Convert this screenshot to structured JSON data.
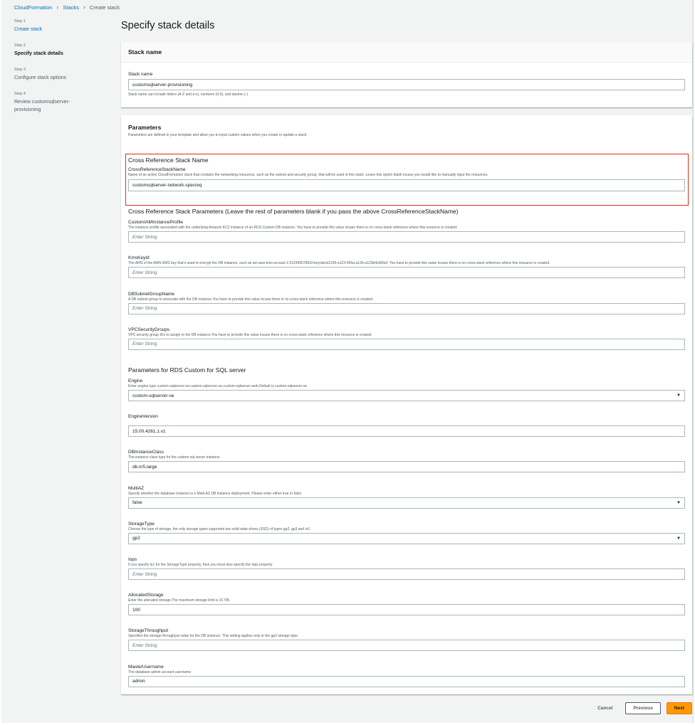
{
  "breadcrumb": {
    "items": [
      "CloudFormation",
      "Stacks",
      "Create stack"
    ]
  },
  "steps": [
    {
      "num": "Step 1",
      "label": "Create stack"
    },
    {
      "num": "Step 2",
      "label": "Specify stack details"
    },
    {
      "num": "Step 3",
      "label": "Configure stack options"
    },
    {
      "num": "Step 4",
      "label": "Review customsqlserver-provisioning"
    }
  ],
  "page_title": "Specify stack details",
  "stack_name_panel": {
    "title": "Stack name",
    "label": "Stack name",
    "value": "customsqlserver-provisioning",
    "hint": "Stack name can include letters (A-Z and a-z), numbers (0-9), and dashes (-)."
  },
  "parameters_panel": {
    "title": "Parameters",
    "desc": "Parameters are defined in your template and allow you to input custom values when you create or update a stack.",
    "crossref": {
      "heading": "Cross Reference Stack Name",
      "label": "CrossReferenceStackName",
      "desc": "Name of an active CloudFormation stack that contains the networking resources, such as the subnet and security group, that will be used in this stack. Leave this option blank incase you would like to manually input the resources.",
      "value": "customsqlserver-network-specreq"
    },
    "crossref_params_heading": "Cross Reference Stack Parameters (Leave the rest of parameters blank if you pass the above CrossReferenceStackName)",
    "crossref_fields": [
      {
        "label": "CustomIAMInstanceProfile",
        "desc": "The instance profile associated with the underlying Amazon EC2 instance of an RDS Custom DB instance. You have to provide this value incase there is no cross-stack reference where this resource is created.",
        "placeholder": "Enter String"
      },
      {
        "label": "KmsKeyId",
        "desc": "The ARN of the AWS KMS key that's used to encrypt the DB instance, such as arn:aws:kms:us-east-1:012345678910:key/abcd1234-a123-456a-a12b-a123b4cd56ef. You have to provide this value incase there is no cross-stack reference where this resource is created.",
        "placeholder": "Enter String"
      },
      {
        "label": "DBSubnetGroupName",
        "desc": "A DB subnet group to associate with the DB instance.You have to provide this value incase there is no cross-stack reference where this resource is created.",
        "placeholder": "Enter String"
      },
      {
        "label": "VPCSecurityGroups",
        "desc": "VPC security group IDs to assign to the DB instance.You have to provide this value incase there is no cross-stack reference where this resource is created.",
        "placeholder": "Enter String"
      }
    ],
    "rds_heading": "Parameters for RDS Custom for SQL server",
    "rds_fields": [
      {
        "label": "Engine",
        "desc": "Enter engine type custom-sqlserver-ee,custom-sqlserver-se,custom-sqlserver-web.Default is custom-sqlserver-se",
        "value": "custom-sqlserver-se",
        "type": "select"
      },
      {
        "label": "EngineVersion",
        "desc": "",
        "value": "15.00.4261.1.v1",
        "type": "input"
      },
      {
        "label": "DBInstanceClass",
        "desc": "The instance class type for the custom sql server instance",
        "value": "db.m5.large",
        "type": "input"
      },
      {
        "label": "MultiAZ",
        "desc": "Specify whether the database instance is a Multi-AZ DB instance deployment. Please enter either true or false",
        "value": "false",
        "type": "select"
      },
      {
        "label": "StorageType",
        "desc": "Choose the type of storage, the only storage types supported are solid state drives (SSD) of types gp2, gp3 and io1.",
        "value": "gp2",
        "type": "select"
      },
      {
        "label": "Iops",
        "desc": "If you specify io1 for the StorageType property, then you must also specify the Iops property",
        "placeholder": "Enter String",
        "type": "input"
      },
      {
        "label": "AllocatedStorage",
        "desc": "Enter the allocated storage.The maximum storage limit is 16 TiB.",
        "value": "100",
        "type": "input"
      },
      {
        "label": "StorageThroughput",
        "desc": "Specifies the storage throughput value for the DB instance. This setting applies only to the gp3 storage type.",
        "placeholder": "Enter String",
        "type": "input"
      },
      {
        "label": "MasterUsername",
        "desc": "The database admin account username",
        "value": "admin",
        "type": "input"
      }
    ]
  },
  "footer": {
    "cancel": "Cancel",
    "previous": "Previous",
    "next": "Next"
  }
}
